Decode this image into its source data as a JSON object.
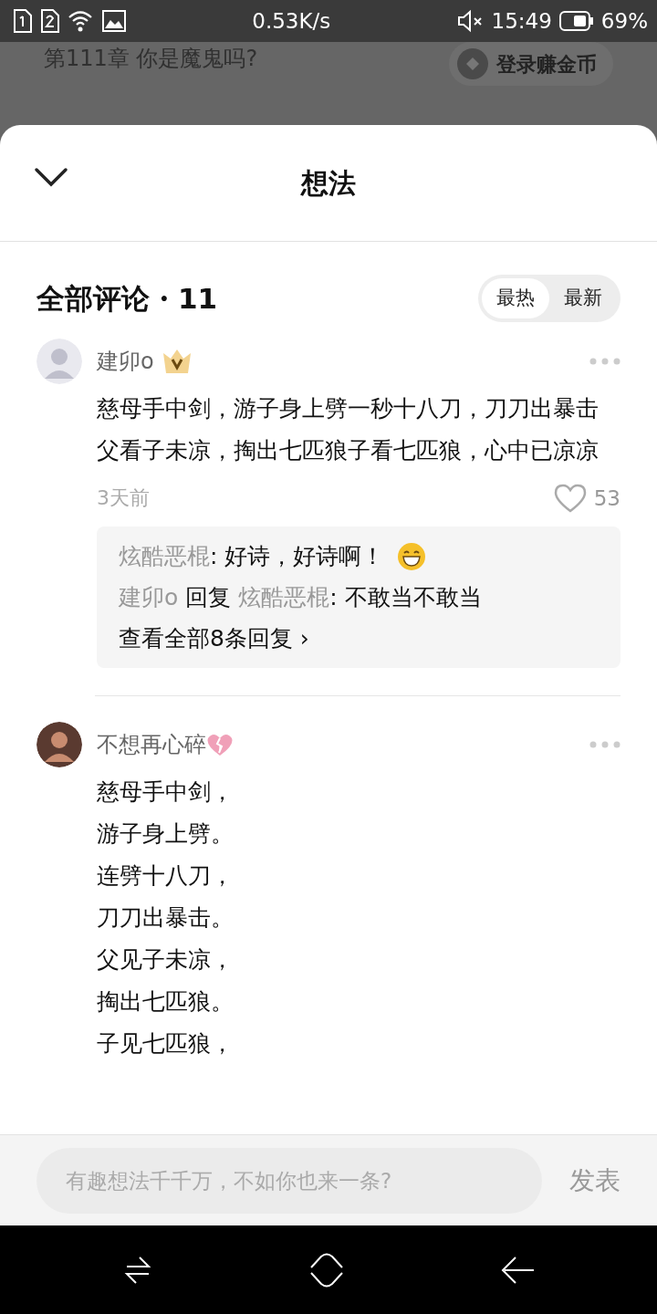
{
  "status_bar": {
    "speed": "0.53K/s",
    "time": "15:49",
    "battery": "69%"
  },
  "background_page": {
    "chapter_title": "第111章 你是魔鬼吗?",
    "login_button": "登录赚金币"
  },
  "sheet": {
    "title": "想法"
  },
  "comments_header": {
    "title": "全部评论・11",
    "sort_tabs": [
      {
        "label": "最热",
        "selected": true
      },
      {
        "label": "最新",
        "selected": false
      }
    ]
  },
  "comments": [
    {
      "author": "建卯o",
      "vip": true,
      "heartbreak": false,
      "lines": [
        "慈母手中剑，游子身上劈一秒十八刀，刀刀出暴击父看子未凉，掏出七匹狼子看七匹狼，心中已凉凉"
      ],
      "time": "3天前",
      "likes": "53",
      "replies": [
        {
          "kind": "comment",
          "author": "炫酷恶棍",
          "text": ": 好诗，好诗啊！",
          "emoji": true
        },
        {
          "kind": "reply",
          "author": "建卯o",
          "verb": "回复",
          "target": "炫酷恶棍",
          "text": ": 不敢当不敢当",
          "emoji": false
        }
      ],
      "more": "查看全部8条回复 ›"
    },
    {
      "author": "不想再心碎",
      "vip": false,
      "heartbreak": true,
      "lines": [
        "慈母手中剑，",
        "游子身上劈。",
        "连劈十八刀，",
        "刀刀出暴击。",
        "父见子未凉，",
        "掏出七匹狼。",
        "子见七匹狼，"
      ]
    }
  ],
  "input_bar": {
    "placeholder": "有趣想法千千万，不如你也来一条?",
    "send": "发表"
  }
}
